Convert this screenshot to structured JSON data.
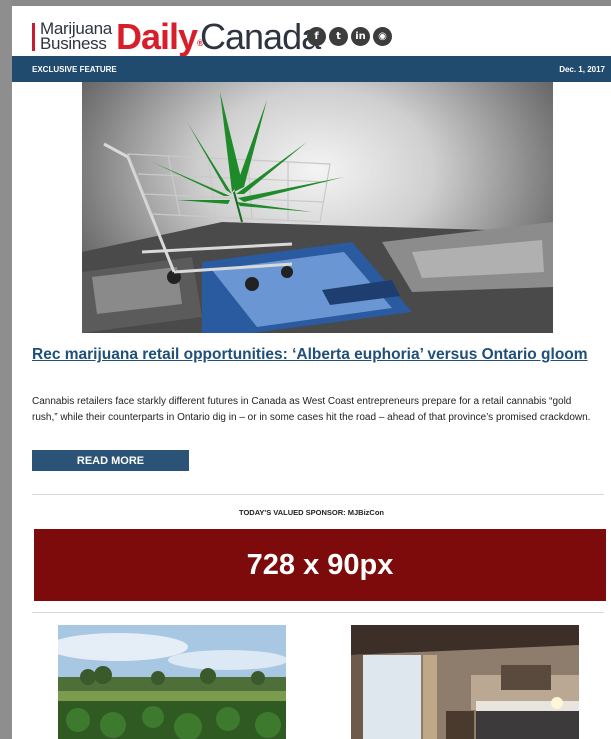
{
  "header": {
    "logo": {
      "line1": "Marijuana",
      "line2": "Business",
      "daily": "Daily",
      "canada": "Canada"
    },
    "social": [
      {
        "icon": "facebook-icon",
        "glyph": "f"
      },
      {
        "icon": "twitter-icon",
        "glyph": "t"
      },
      {
        "icon": "linkedin-icon",
        "glyph": "in"
      },
      {
        "icon": "rss-icon",
        "glyph": "◉"
      }
    ]
  },
  "feature_bar": {
    "label": "EXCLUSIVE FEATURE",
    "date": "Dec. 1, 2017",
    "color": "#204a6e"
  },
  "article": {
    "hero_image": "shopping-cart-with-cannabis-leaf-on-credit-card",
    "headline": "Rec marijuana retail opportunities: ‘Alberta euphoria’ versus Ontario gloom",
    "summary": "Cannabis retailers face starkly different futures in Canada as West Coast entrepreneurs prepare for a retail cannabis “gold rush,” while their counterparts in Ontario dig in – or in some cases hit the road – ahead of that province’s promised crackdown.",
    "read_more_label": "READ MORE"
  },
  "sponsor": {
    "label": "TODAY'S VALUED SPONSOR: MJBizCon",
    "ad_text": "728 x 90px",
    "ad_color": "#7e0b0b"
  },
  "thumbnails": [
    {
      "image": "cannabis-field-landscape"
    },
    {
      "image": "hotel-room-interior"
    }
  ],
  "colors": {
    "brand_red": "#d71e2a",
    "link_blue": "#20507a",
    "button_blue": "#2b5277"
  }
}
